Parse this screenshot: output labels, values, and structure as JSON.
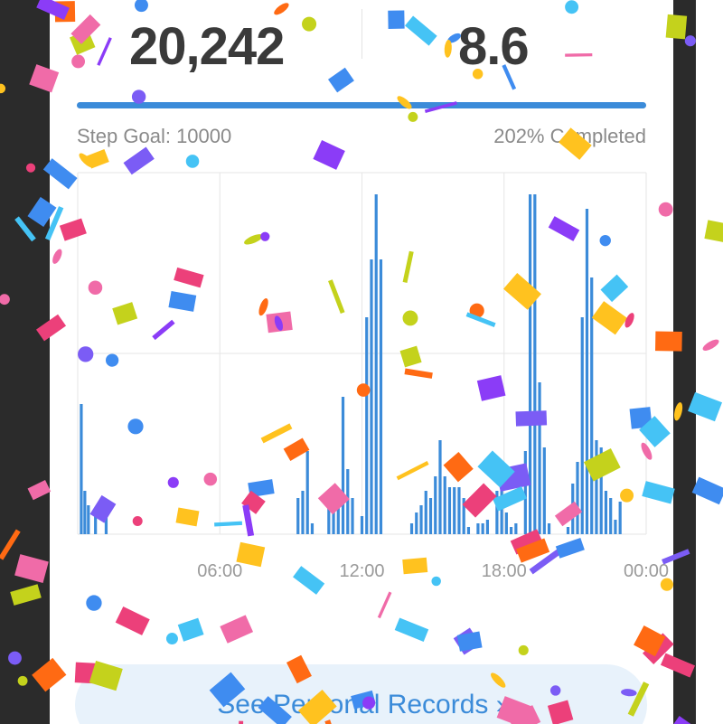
{
  "summary": {
    "steps_value": "20,242",
    "distance_value": "8.6",
    "goal_label": "Step Goal: 10000",
    "completed_label": "202% Completed",
    "progress_fraction": 1.0
  },
  "colors": {
    "accent": "#3b8bd9",
    "background_dark": "#2b2b2b",
    "button_bg": "#e8f2fb"
  },
  "chart_data": {
    "type": "bar",
    "x_tick_labels": [
      "06:00",
      "12:00",
      "18:00",
      "00:00"
    ],
    "x_unit": "hour of day (0-24)",
    "ylim": [
      0,
      100
    ],
    "grid": true,
    "bars": [
      {
        "x": 0.15,
        "y": 36
      },
      {
        "x": 0.3,
        "y": 12
      },
      {
        "x": 0.45,
        "y": 8
      },
      {
        "x": 0.75,
        "y": 6
      },
      {
        "x": 1.2,
        "y": 5
      },
      {
        "x": 9.3,
        "y": 10
      },
      {
        "x": 9.5,
        "y": 12
      },
      {
        "x": 9.7,
        "y": 23
      },
      {
        "x": 9.9,
        "y": 3
      },
      {
        "x": 10.6,
        "y": 11
      },
      {
        "x": 10.8,
        "y": 11
      },
      {
        "x": 11.0,
        "y": 10
      },
      {
        "x": 11.2,
        "y": 38
      },
      {
        "x": 11.4,
        "y": 18
      },
      {
        "x": 11.6,
        "y": 10
      },
      {
        "x": 12.0,
        "y": 5
      },
      {
        "x": 12.2,
        "y": 60
      },
      {
        "x": 12.4,
        "y": 76
      },
      {
        "x": 12.6,
        "y": 94
      },
      {
        "x": 12.8,
        "y": 76
      },
      {
        "x": 14.1,
        "y": 3
      },
      {
        "x": 14.3,
        "y": 6
      },
      {
        "x": 14.5,
        "y": 8
      },
      {
        "x": 14.7,
        "y": 12
      },
      {
        "x": 14.9,
        "y": 10
      },
      {
        "x": 15.1,
        "y": 16
      },
      {
        "x": 15.3,
        "y": 26
      },
      {
        "x": 15.5,
        "y": 16
      },
      {
        "x": 15.7,
        "y": 13
      },
      {
        "x": 15.9,
        "y": 13
      },
      {
        "x": 16.1,
        "y": 13
      },
      {
        "x": 16.3,
        "y": 10
      },
      {
        "x": 16.5,
        "y": 2
      },
      {
        "x": 16.9,
        "y": 3
      },
      {
        "x": 17.1,
        "y": 3
      },
      {
        "x": 17.3,
        "y": 4
      },
      {
        "x": 17.7,
        "y": 12
      },
      {
        "x": 17.9,
        "y": 14
      },
      {
        "x": 18.1,
        "y": 6
      },
      {
        "x": 18.3,
        "y": 2
      },
      {
        "x": 18.5,
        "y": 3
      },
      {
        "x": 18.9,
        "y": 23
      },
      {
        "x": 19.1,
        "y": 94
      },
      {
        "x": 19.3,
        "y": 94
      },
      {
        "x": 19.5,
        "y": 42
      },
      {
        "x": 19.7,
        "y": 24
      },
      {
        "x": 19.9,
        "y": 3
      },
      {
        "x": 20.7,
        "y": 2
      },
      {
        "x": 20.9,
        "y": 14
      },
      {
        "x": 21.1,
        "y": 20
      },
      {
        "x": 21.3,
        "y": 60
      },
      {
        "x": 21.5,
        "y": 90
      },
      {
        "x": 21.7,
        "y": 71
      },
      {
        "x": 21.9,
        "y": 26
      },
      {
        "x": 22.1,
        "y": 24
      },
      {
        "x": 22.3,
        "y": 12
      },
      {
        "x": 22.5,
        "y": 10
      },
      {
        "x": 22.7,
        "y": 4
      },
      {
        "x": 22.9,
        "y": 9
      }
    ]
  },
  "records_button_label": "See Personal Records ›"
}
